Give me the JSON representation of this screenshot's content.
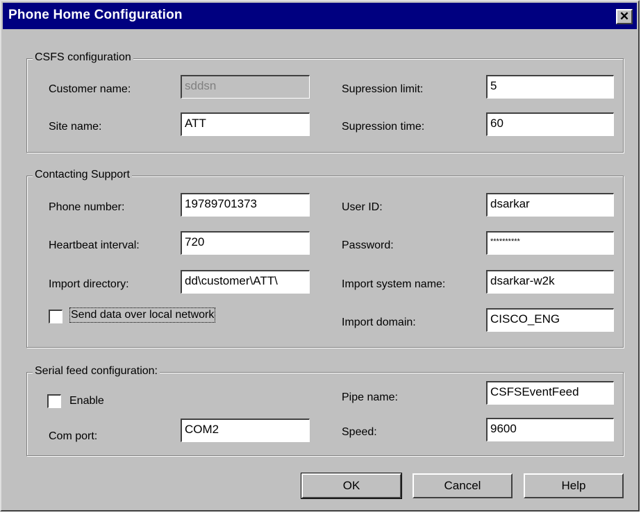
{
  "window": {
    "title": "Phone Home Configuration",
    "close_glyph": "✕"
  },
  "csfs": {
    "legend": "CSFS configuration",
    "customer_name": {
      "label": "Customer name:",
      "value": "sddsn"
    },
    "site_name": {
      "label": "Site name:",
      "value": "ATT"
    },
    "supression_limit": {
      "label": "Supression limit:",
      "value": "5"
    },
    "supression_time": {
      "label": "Supression time:",
      "value": "60"
    }
  },
  "support": {
    "legend": "Contacting Support",
    "phone_number": {
      "label": "Phone number:",
      "value": "19789701373"
    },
    "heartbeat_interval": {
      "label": "Heartbeat interval:",
      "value": "720"
    },
    "import_directory": {
      "label": "Import directory:",
      "value": "dd\\customer\\ATT\\"
    },
    "send_local": {
      "label": "Send data over local network",
      "checked": false
    },
    "user_id": {
      "label": "User ID:",
      "value": "dsarkar"
    },
    "password": {
      "label": "Password:",
      "value": "**********"
    },
    "import_system_name": {
      "label": "Import system name:",
      "value": "dsarkar-w2k"
    },
    "import_domain": {
      "label": "Import domain:",
      "value": "CISCO_ENG"
    }
  },
  "serial": {
    "legend": "Serial feed configuration:",
    "enable": {
      "label": "Enable",
      "checked": false
    },
    "com_port": {
      "label": "Com port:",
      "value": "COM2"
    },
    "pipe_name": {
      "label": "Pipe name:",
      "value": "CSFSEventFeed"
    },
    "speed": {
      "label": "Speed:",
      "value": "9600"
    }
  },
  "buttons": {
    "ok": "OK",
    "cancel": "Cancel",
    "help": "Help"
  }
}
